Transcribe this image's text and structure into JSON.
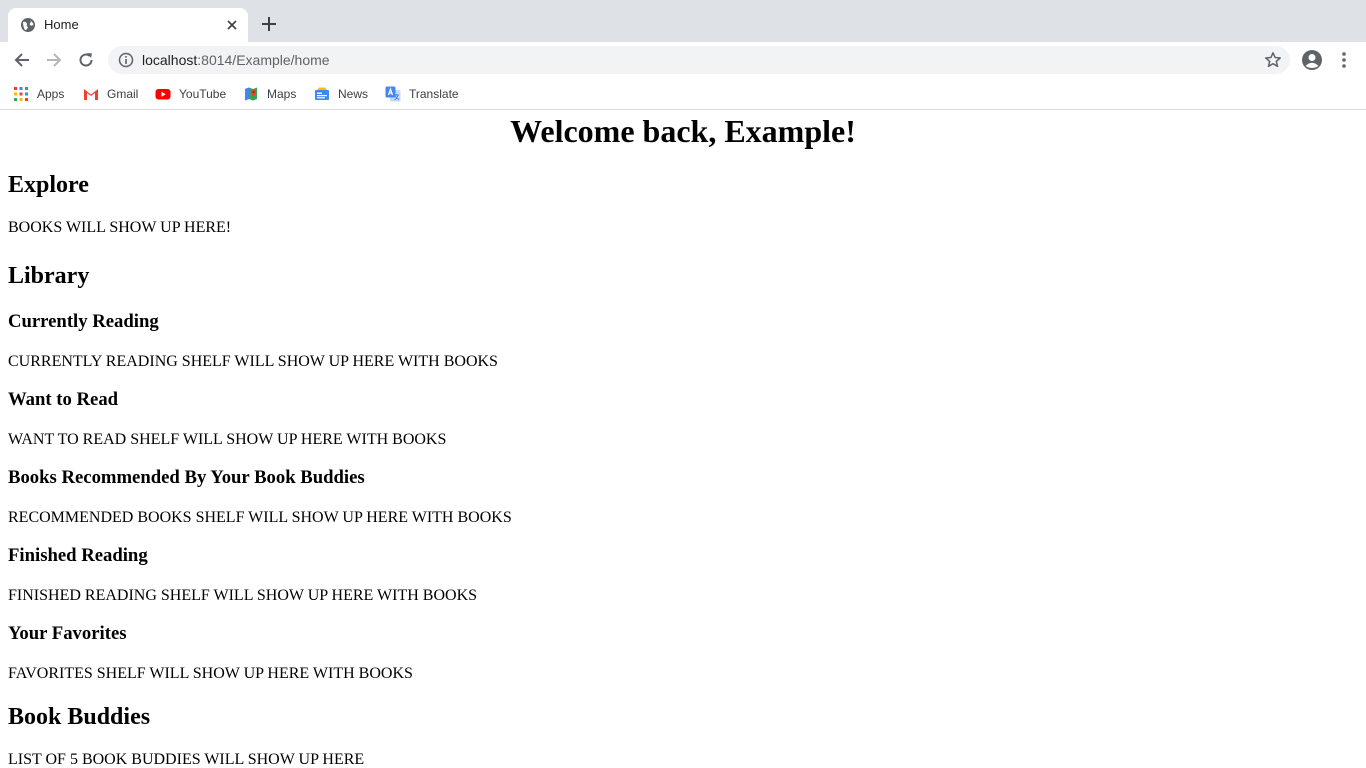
{
  "browser": {
    "tab": {
      "title": "Home"
    },
    "address": {
      "host": "localhost",
      "rest": ":8014/Example/home"
    },
    "bookmarks": [
      {
        "label": "Apps",
        "icon": "apps-grid-icon"
      },
      {
        "label": "Gmail",
        "icon": "gmail-icon"
      },
      {
        "label": "YouTube",
        "icon": "youtube-icon"
      },
      {
        "label": "Maps",
        "icon": "maps-icon"
      },
      {
        "label": "News",
        "icon": "news-icon"
      },
      {
        "label": "Translate",
        "icon": "translate-icon"
      }
    ]
  },
  "page": {
    "welcome": "Welcome back, Example!",
    "explore": {
      "heading": "Explore",
      "placeholder": "BOOKS WILL SHOW UP HERE!"
    },
    "library": {
      "heading": "Library",
      "shelves": [
        {
          "title": "Currently Reading",
          "placeholder": "CURRENTLY READING SHELF WILL SHOW UP HERE WITH BOOKS"
        },
        {
          "title": "Want to Read",
          "placeholder": "WANT TO READ SHELF WILL SHOW UP HERE WITH BOOKS"
        },
        {
          "title": "Books Recommended By Your Book Buddies",
          "placeholder": "RECOMMENDED BOOKS SHELF WILL SHOW UP HERE WITH BOOKS"
        },
        {
          "title": "Finished Reading",
          "placeholder": "FINISHED READING SHELF WILL SHOW UP HERE WITH BOOKS"
        },
        {
          "title": "Your Favorites",
          "placeholder": "FAVORITES SHELF WILL SHOW UP HERE WITH BOOKS"
        }
      ]
    },
    "buddies": {
      "heading": "Book Buddies",
      "placeholder": "LIST OF 5 BOOK BUDDIES WILL SHOW UP HERE"
    }
  },
  "colors": {
    "tabstrip": "#dee1e6",
    "omnibox": "#f1f3f4",
    "text": "#000000"
  }
}
